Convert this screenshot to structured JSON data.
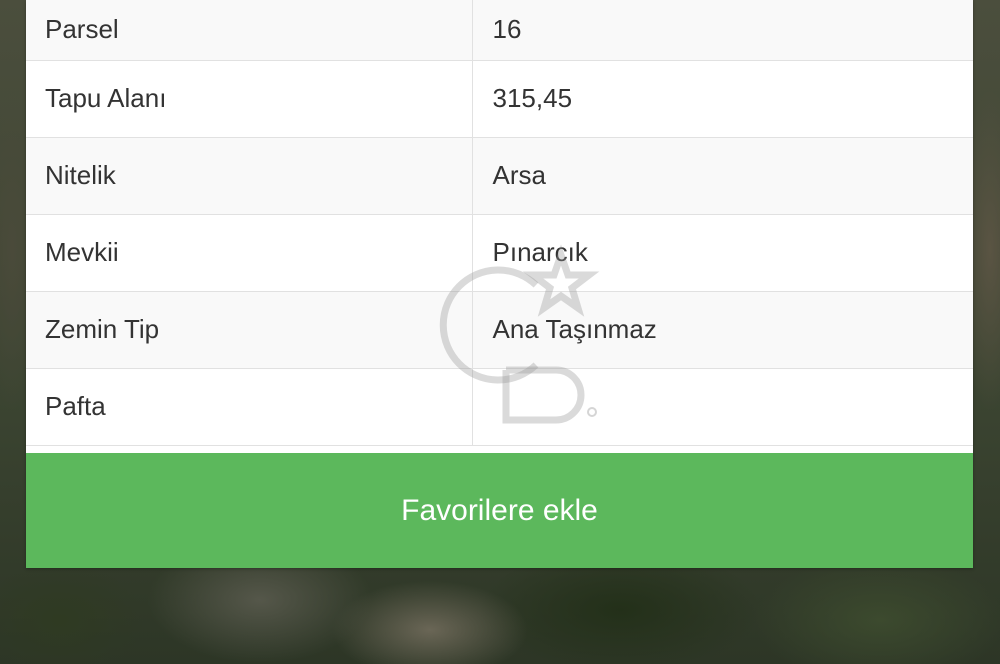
{
  "property_details": {
    "rows": [
      {
        "label": "Parsel",
        "value": "16"
      },
      {
        "label": "Tapu Alanı",
        "value": "315,45"
      },
      {
        "label": "Nitelik",
        "value": "Arsa"
      },
      {
        "label": "Mevkii",
        "value": "Pınarcık"
      },
      {
        "label": "Zemin Tip",
        "value": "Ana Taşınmaz"
      },
      {
        "label": "Pafta",
        "value": ""
      }
    ]
  },
  "actions": {
    "add_favorites_label": "Favorilere ekle"
  },
  "colors": {
    "button_green": "#5cb85c",
    "row_stripe": "#f9f9f9",
    "border": "#e1e1e1"
  },
  "icons": {
    "watermark": "cb-logo-watermark"
  }
}
